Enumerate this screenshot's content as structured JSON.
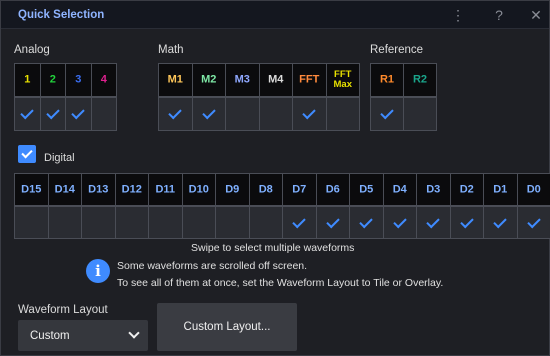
{
  "window": {
    "title": "Quick Selection"
  },
  "icons": {
    "menu": "kebab-menu-icon",
    "help": "help-icon",
    "close": "close-icon"
  },
  "titlebar_controls": {
    "menu": "⋮",
    "help": "?",
    "close": "✕"
  },
  "groups": {
    "analog": "Analog",
    "math": "Math",
    "reference": "Reference"
  },
  "analog": [
    {
      "label": "1",
      "color": "#e8e200",
      "checked": true
    },
    {
      "label": "2",
      "color": "#22d23c",
      "checked": true
    },
    {
      "label": "3",
      "color": "#3a6df0",
      "checked": true
    },
    {
      "label": "4",
      "color": "#e0208f",
      "checked": false
    }
  ],
  "math": [
    {
      "label": "M1",
      "color": "#ffc75a",
      "checked": true
    },
    {
      "label": "M2",
      "color": "#7ee8a6",
      "checked": true
    },
    {
      "label": "M3",
      "color": "#8fa8ff",
      "checked": false
    },
    {
      "label": "M4",
      "color": "#dcdcdc",
      "checked": false
    },
    {
      "label": "FFT",
      "color": "#ff8a3d",
      "checked": true
    },
    {
      "label": "FFT Max",
      "color": "#e8e200",
      "checked": false
    }
  ],
  "reference": [
    {
      "label": "R1",
      "color": "#ff8a2b",
      "checked": true
    },
    {
      "label": "R2",
      "color": "#1aa58b",
      "checked": false
    }
  ],
  "digital": {
    "label": "Digital",
    "checked": true,
    "color": "#7fb0ff",
    "channels": [
      {
        "label": "D15",
        "checked": false
      },
      {
        "label": "D14",
        "checked": false
      },
      {
        "label": "D13",
        "checked": false
      },
      {
        "label": "D12",
        "checked": false
      },
      {
        "label": "D11",
        "checked": false
      },
      {
        "label": "D10",
        "checked": false
      },
      {
        "label": "D9",
        "checked": false
      },
      {
        "label": "D8",
        "checked": false
      },
      {
        "label": "D7",
        "checked": true
      },
      {
        "label": "D6",
        "checked": true
      },
      {
        "label": "D5",
        "checked": true
      },
      {
        "label": "D4",
        "checked": true
      },
      {
        "label": "D3",
        "checked": true
      },
      {
        "label": "D2",
        "checked": true
      },
      {
        "label": "D1",
        "checked": true
      },
      {
        "label": "D0",
        "checked": true
      }
    ]
  },
  "hints": {
    "swipe": "Swipe to select multiple waveforms",
    "scrolled": "Some waveforms are scrolled off screen.",
    "tile": "To see all of them at once, set the Waveform Layout to Tile or Overlay."
  },
  "info_icon": "i",
  "layout": {
    "label": "Waveform Layout",
    "value": "Custom",
    "button": "Custom Layout..."
  }
}
